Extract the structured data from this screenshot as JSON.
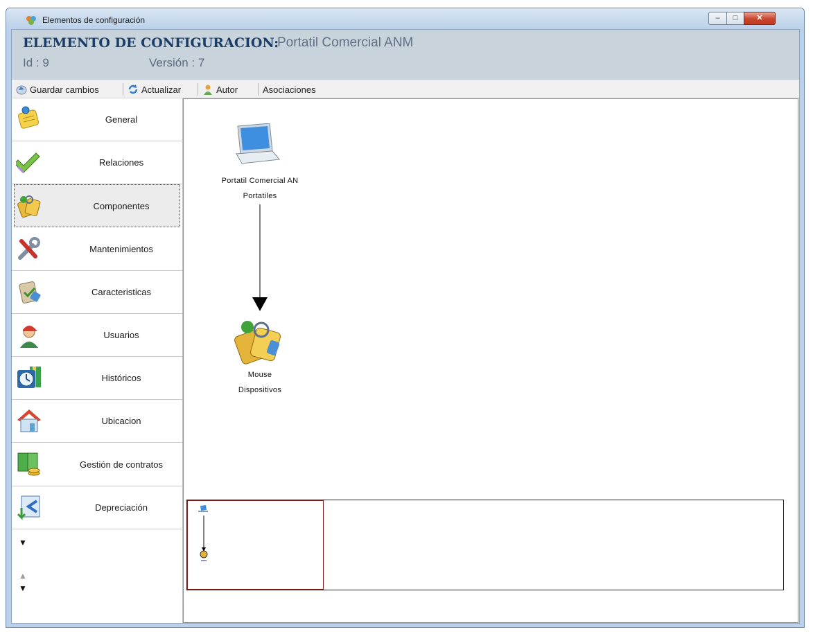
{
  "window": {
    "title": "Elementos de configuración",
    "controls": [
      "minimize-icon",
      "maximize-icon",
      "close-icon"
    ]
  },
  "header": {
    "label": "ELEMENTO DE CONFIGURACION:",
    "value": "Portatil Comercial ANM",
    "id_label": "Id",
    "id_value": "9",
    "version_label": "Versión",
    "version_value": "7"
  },
  "toolbar": {
    "save_label": "Guardar cambios",
    "refresh_label": "Actualizar",
    "author_label": "Autor",
    "associations_label": "Asociaciones"
  },
  "sidebar": {
    "items": [
      {
        "label": "General",
        "icon": "notepad-pencil-icon"
      },
      {
        "label": "Relaciones",
        "icon": "double-check-icon"
      },
      {
        "label": "Componentes",
        "icon": "tags-icon",
        "selected": true
      },
      {
        "label": "Mantenimientos",
        "icon": "tools-icon"
      },
      {
        "label": "Caracteristicas",
        "icon": "clipboard-check-icon"
      },
      {
        "label": "Usuarios",
        "icon": "user-icon"
      },
      {
        "label": "Históricos",
        "icon": "clock-icon"
      },
      {
        "label": "Ubicacion",
        "icon": "house-icon"
      },
      {
        "label": "Gestión de contratos",
        "icon": "money-icon"
      },
      {
        "label": "Depreciación",
        "icon": "depreciation-icon"
      }
    ]
  },
  "diagram": {
    "nodes": [
      {
        "name": "Portatil Comercial AN",
        "category": "Portatiles",
        "icon": "laptop-icon"
      },
      {
        "name": "Mouse",
        "category": "Dispositivos",
        "icon": "tags-icon"
      }
    ],
    "edges": [
      {
        "from": "Portatil Comercial AN",
        "to": "Mouse"
      }
    ]
  },
  "colors": {
    "header_title": "#1b3e66",
    "header_bg": "#c9d3dc",
    "window_frame": "#b9d1ea",
    "close_button": "#c9452c"
  }
}
